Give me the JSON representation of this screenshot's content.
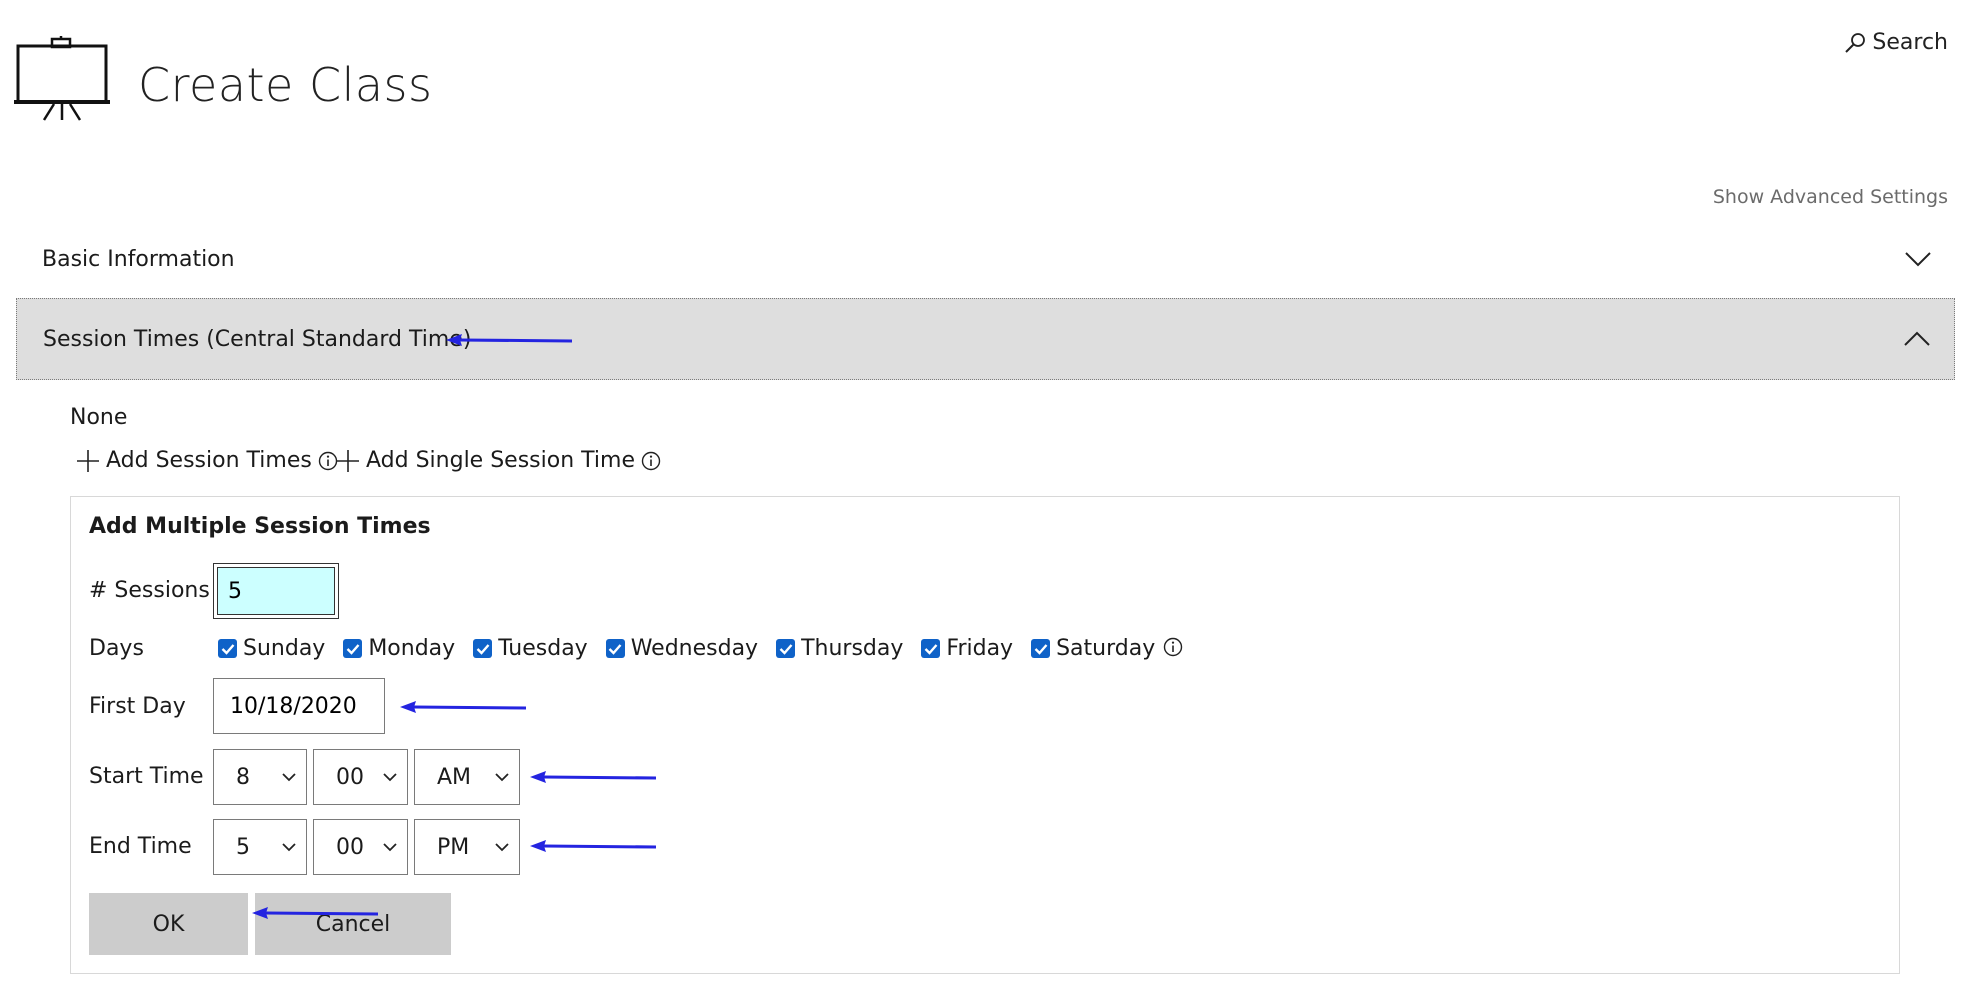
{
  "header": {
    "title": "Create Class",
    "search_label": "Search",
    "advanced_link": "Show Advanced Settings"
  },
  "accordion": {
    "basic_label": "Basic Information",
    "session_label": "Session Times (Central Standard Time)"
  },
  "session": {
    "empty_text": "None",
    "add_multi_label": "Add Session Times",
    "add_single_label": "Add Single Session Time"
  },
  "panel": {
    "title": "Add Multiple Session Times",
    "sessions_label": "# Sessions",
    "sessions_value": "5",
    "days_label": "Days",
    "days": [
      {
        "label": "Sunday",
        "checked": true
      },
      {
        "label": "Monday",
        "checked": true
      },
      {
        "label": "Tuesday",
        "checked": true
      },
      {
        "label": "Wednesday",
        "checked": true
      },
      {
        "label": "Thursday",
        "checked": true
      },
      {
        "label": "Friday",
        "checked": true
      },
      {
        "label": "Saturday",
        "checked": true
      }
    ],
    "first_day_label": "First Day",
    "first_day_value": "10/18/2020",
    "start_time_label": "Start Time",
    "start_hour": "8",
    "start_minute": "00",
    "start_ampm": "AM",
    "end_time_label": "End Time",
    "end_hour": "5",
    "end_minute": "00",
    "end_ampm": "PM",
    "ok_label": "OK",
    "cancel_label": "Cancel"
  },
  "colors": {
    "checkbox": "#0f62c8",
    "sessions_field_bg": "#ccffff",
    "accordion_active_bg": "#dedede",
    "button_bg": "#cccccc",
    "annotation_arrow": "#2424e0"
  },
  "icons": [
    "class-presentation-icon",
    "search-icon",
    "chevron-down-icon",
    "chevron-up-icon",
    "plus-icon",
    "info-icon",
    "checkmark-icon",
    "caret-down-icon",
    "annotation-arrow-icon"
  ]
}
